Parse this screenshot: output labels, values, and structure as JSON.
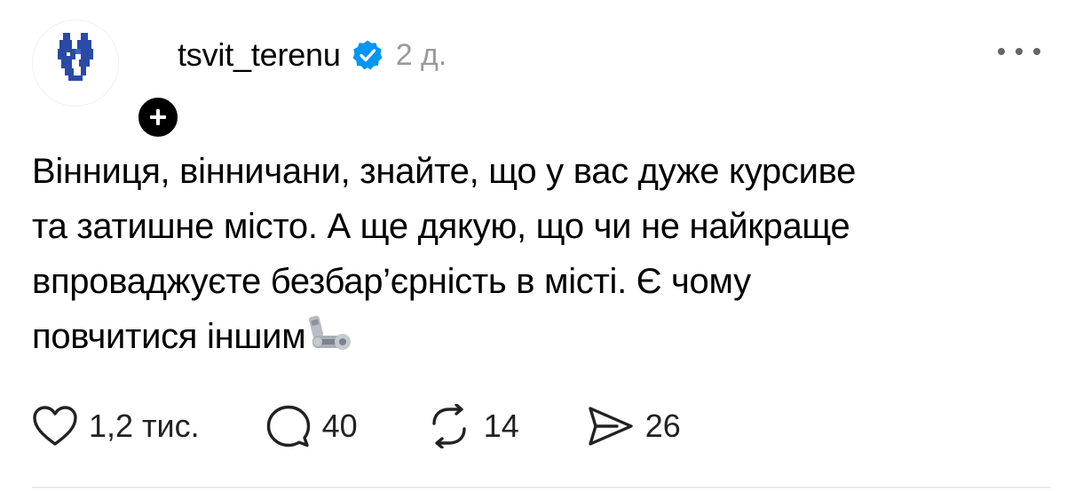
{
  "post": {
    "author": {
      "username": "tsvit_terenu",
      "verified": true,
      "avatar_icon": "tsvit-terenu-logo-icon",
      "follow_icon": "plus-icon"
    },
    "timestamp": "2 д.",
    "more_icon": "more-dots-icon",
    "text_lines": [
      "Вінниця, вінничани, знайте, що у вас дуже курсиве",
      "та затишне місто. А ще дякую, що чи не найкраще",
      "впроваджуєте безбар’єрність в місті. Є чому",
      "повчитися іншим"
    ],
    "text_emoji": "mechanical-arm-emoji"
  },
  "actions": {
    "like": {
      "icon": "heart-icon",
      "count": "1,2 тис."
    },
    "reply": {
      "icon": "comment-icon",
      "count": "40"
    },
    "repost": {
      "icon": "repost-icon",
      "count": "14"
    },
    "share": {
      "icon": "send-icon",
      "count": "26"
    }
  },
  "colors": {
    "verified_badge": "#0095f6",
    "avatar_logo": "#2b4aa6",
    "timestamp": "#9a9a9a",
    "text": "#000000"
  }
}
